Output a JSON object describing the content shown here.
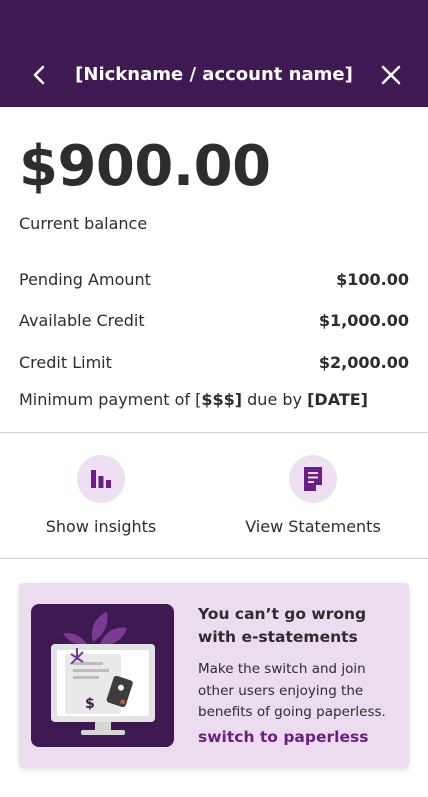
{
  "header": {
    "title": "[Nickname / account name]",
    "back_icon": "chevron-left-icon",
    "close_icon": "close-icon"
  },
  "balance": {
    "amount": "$900.00",
    "label": "Current balance"
  },
  "details": [
    {
      "label": "Pending Amount",
      "value": "$100.00"
    },
    {
      "label": "Available Credit",
      "value": "$1,000.00"
    },
    {
      "label": "Credit Limit",
      "value": "$2,000.00"
    }
  ],
  "minimum_payment": {
    "prefix": "Minimum payment of [",
    "amount": "$$$]",
    "middle": " due by ",
    "date": "[DATE]"
  },
  "actions": [
    {
      "label": "Show insights",
      "icon": "bar-chart-icon"
    },
    {
      "label": "View Statements",
      "icon": "document-icon"
    }
  ],
  "promo": {
    "heading": "You can’t go wrong with e-statements",
    "body": "Make the switch and join other users enjoying the benefits of going paperless.",
    "link": "switch to paperless",
    "illustration": "computer-paperless-illustration"
  },
  "colors": {
    "header_bg": "#3f1a52",
    "accent": "#6b1f86",
    "icon_circle_bg": "#eedff2",
    "promo_bg": "#ecdcf0"
  }
}
